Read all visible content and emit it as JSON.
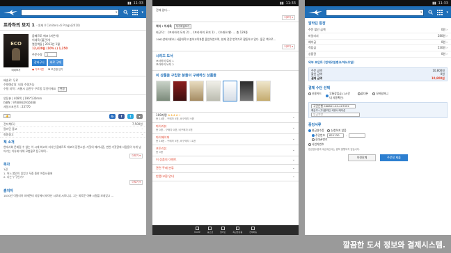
{
  "status_time": "11:33",
  "p1": {
    "title": "프라하의 묘지 1",
    "subtitle": "- 원제 Il Cimitero di Praga(2010)",
    "cover_text": "ECO",
    "preview": "미리보기",
    "author": "움베르토 에코 (지은이)",
    "translator": "이세욱 (옮긴이)",
    "publisher": "열린책들 | 2013년 1월",
    "price": "12,420원 (10%↓) 1,250",
    "qty_label": "주문수량",
    "qty_value": "1",
    "cart_btn": "장바구니",
    "buy_btn": "바로 구매",
    "gift": "● 기프티콘",
    "wish": "♥ 보관함 담기",
    "shipping": [
      "배송료: 무료",
      "수령예상일: 내일 수령가능",
      "수령 지역 : 서울시 금천구 구로동 무엇이에요"
    ],
    "change_btn": "변경",
    "specs": [
      "양장본 | 408쪽 | 196*130mm",
      "ISBN : 9788932916088",
      "세일즈포인트 : 23770"
    ],
    "table": [
      [
        "전자책(1)",
        "7,500원"
      ],
      [
        "알라딘 중고",
        "-"
      ],
      [
        "회원중고",
        "-"
      ]
    ],
    "book_intro_h": "책 소개",
    "book_intro": "현대사회 문제점 수 없는 이 시대 최고의 지식인 움베르토 에코의 장편소설. 거짓의 메커니즘, 변한 거짓말에 사람들이 속게 넘어가는 이유에 대해 모험물로 탐구하며...",
    "more": "더보기 ▾",
    "toc_h": "목차",
    "toc": [
      "1권",
      "1. 어느 봄인이 있었고 꾸중 종한 여정사결에",
      "2. 나는 누구인가?"
    ],
    "author_h": "출저자",
    "author_txt": "1830년 이탈리아 피에몬테 지방에서 태어난 시모네 시모니니. 그는 외로운 아빠 시절을 보내었고 ..."
  },
  "p2": {
    "top_text": "전에 있다...",
    "more": "더보기 ▾",
    "translator": "역자 : 이세욱",
    "translator_btn": "작가파일보기",
    "tr_latest": "최근작 : 《프라하의 묘지 2》,《프라하의 묘지 1》,《오래오래》... 총 129종",
    "tr_desc": "1962년에 태어나 서울대학교 불어교육과를 졸업하였으며, 현재 전문 번역가로 활동하고 있다. 옮긴 책으로...",
    "series_h": "시리즈 도서",
    "series": [
      "프라하의 묘지 1",
      "프라하의 묘지 2"
    ],
    "also_h": "이 상품을 구입한 분들이 구매하신 상품들",
    "review_title": "100자평",
    "review_stars": "★★★★☆",
    "review_meta": "총 14편 - 구매자 5편, 비구매자 9편",
    "mylibrary": "마이리뷰",
    "mylib_meta": "총 0편 - 구매자 0편, 비구매자 0편",
    "paper": "마이페이퍼",
    "paper_meta": "총 16편 - 구매자 5편, 비구매자 11편",
    "photo": "포토리뷰",
    "photo_meta": "총 0편",
    "event": "이 상품의 이벤트",
    "related": "관련 주제 분류",
    "policy": "반품/교환 안내",
    "nav": [
      "HOME",
      "중고샵",
      "알라딘",
      "최근본상품",
      "전체메뉴"
    ]
  },
  "p3": {
    "title_h": "알라딘 통장",
    "rows": [
      [
        "주문 할인 금액",
        "0원"
      ],
      [
        "마일리지",
        "280원"
      ],
      [
        "예치금",
        "0원"
      ],
      [
        "적립금",
        "530원"
      ],
      [
        "상품권",
        "0원"
      ]
    ],
    "ext_h": "외부 포인트 (현대오일뱅크/에쓰오일)",
    "sum": [
      [
        "주문 금액",
        "10,800원"
      ],
      [
        "할인 금액",
        "0원"
      ],
      [
        "결제 금액",
        "10,800원"
      ]
    ],
    "pay_h": "결제 수단 선택",
    "pay_opts": [
      "신용카드",
      "무통장입금 (1시간 내 자동확인)",
      "휴대폰",
      "모바일머니"
    ],
    "account": "국민은행 068801-00-423392",
    "depositor_label": "예금주: (주)알라딘 커뮤니케이션",
    "depositor_input": "입금자명",
    "receipt_h": "증빙서류",
    "receipt_opts": [
      "현금영수증",
      "신청하지 않음"
    ],
    "receipt_sub": [
      "주민번호",
      "휴대폰번호"
    ],
    "rrn_value": "821130",
    "biz": "사업자번호",
    "notice": "현금영수증과 세금계산서는 중복 발행되지 않습니다.",
    "prev_btn": "이전단계",
    "order_btn": "주문정 제출"
  },
  "caption": "깔끔한 도서 정보와 결제시스템."
}
